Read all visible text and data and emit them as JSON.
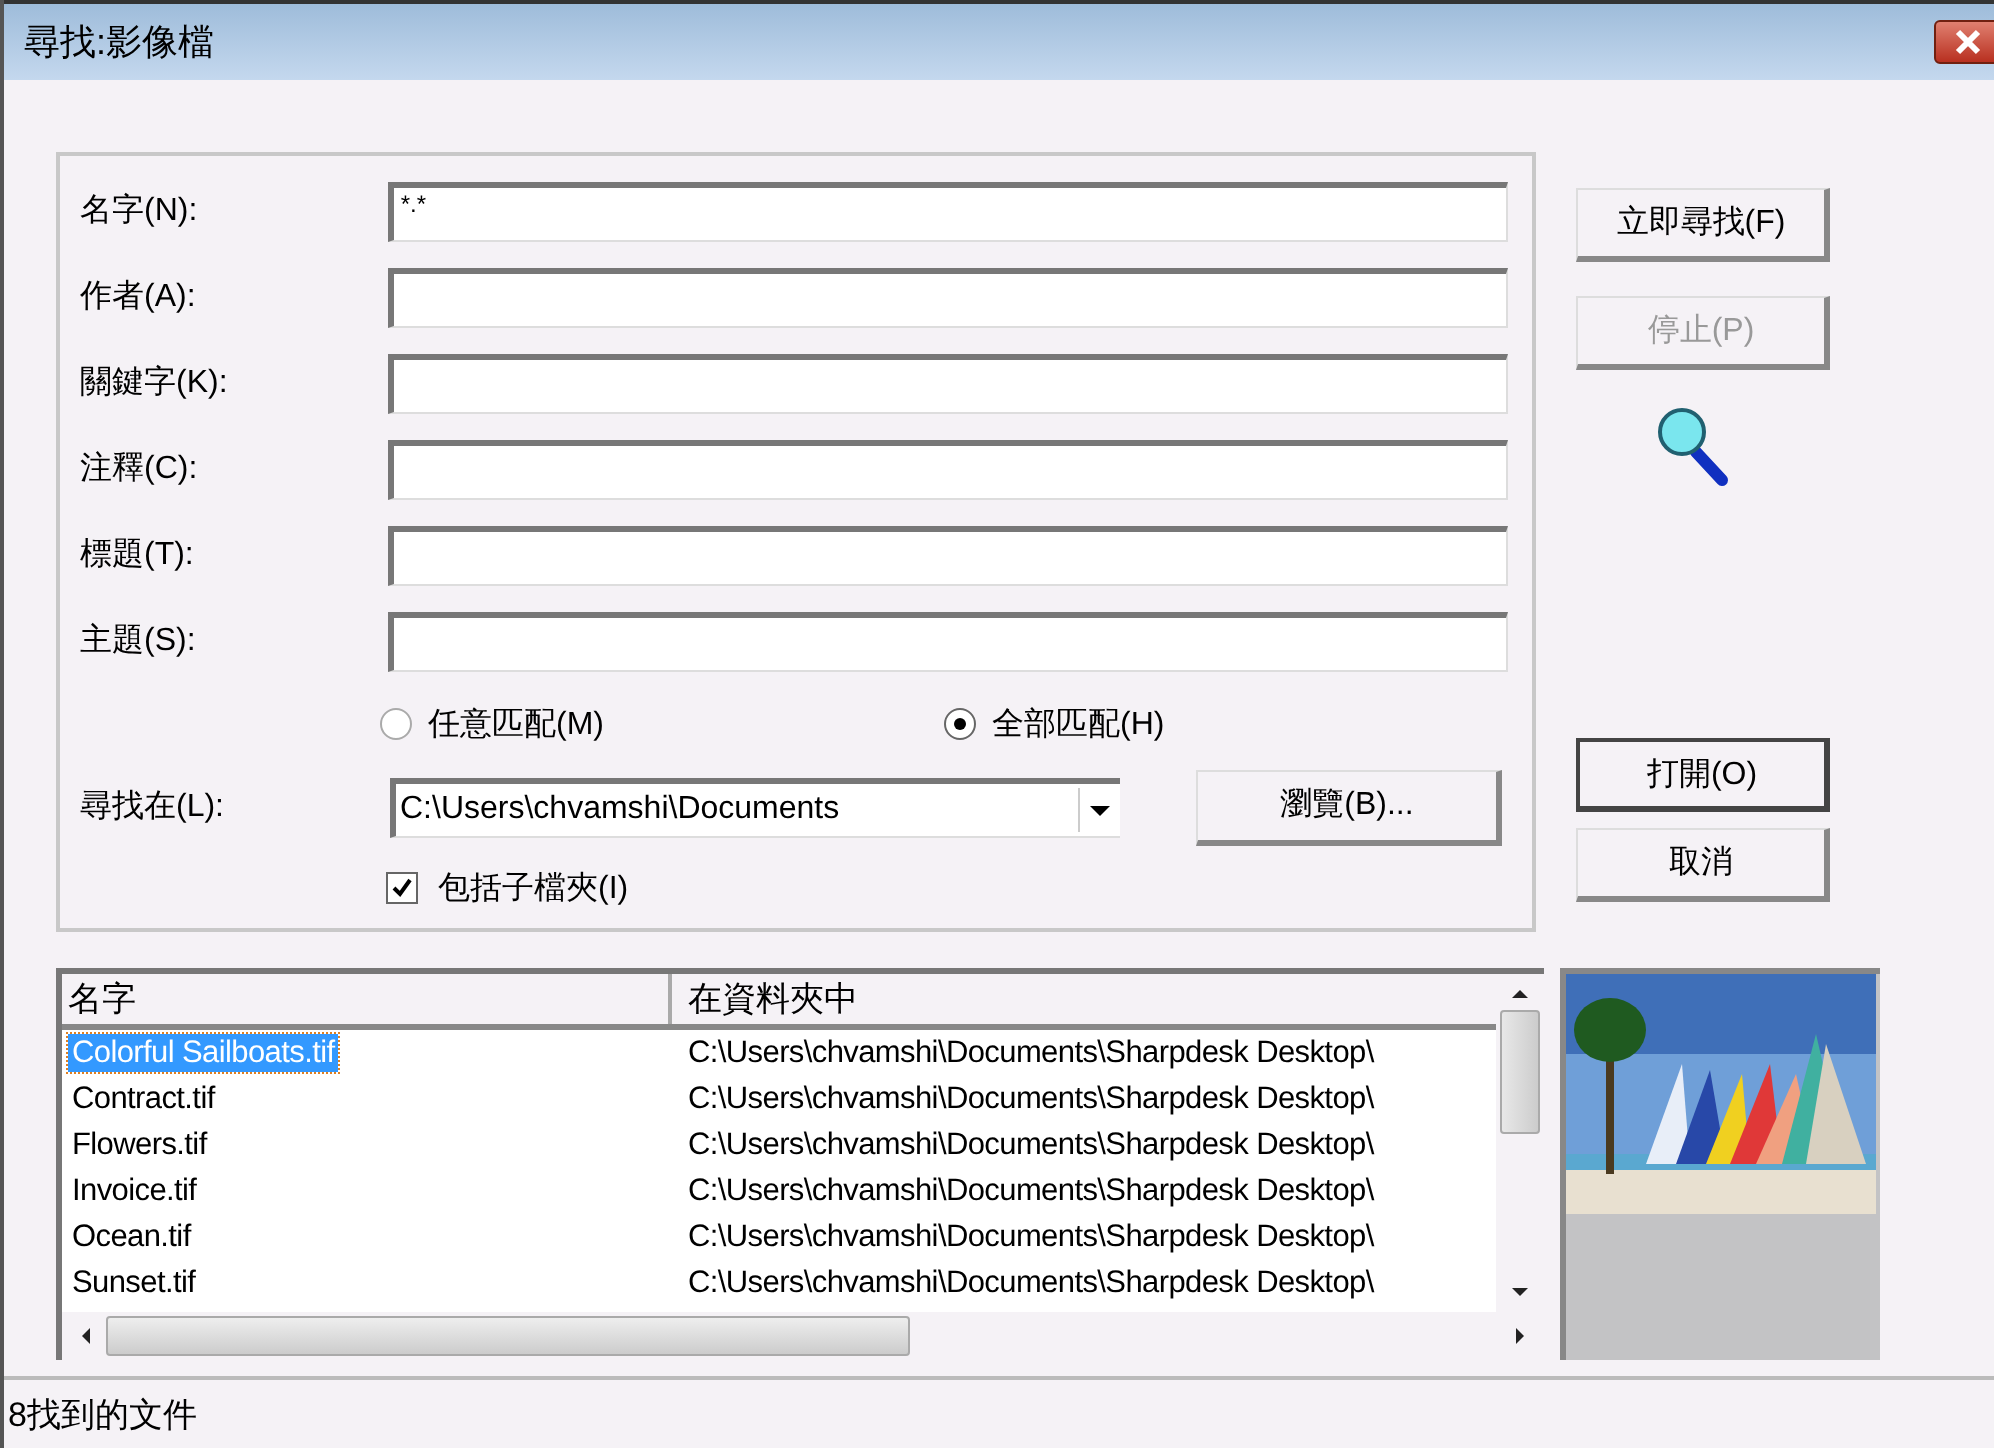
{
  "window": {
    "title": "尋找:影像檔"
  },
  "fields": [
    {
      "label": "名字(N):",
      "value": "*.*"
    },
    {
      "label": "作者(A):"
    },
    {
      "label": "關鍵字(K):"
    },
    {
      "label": "注釋(C):"
    },
    {
      "label": "標題(T):"
    },
    {
      "label": "主題(S):"
    }
  ],
  "match": [
    {
      "label": "任意匹配(M)",
      "selected": false
    },
    {
      "label": "全部匹配(H)",
      "selected": true
    }
  ],
  "look_in": {
    "label": "尋找在(L):",
    "value": "C:\\Users\\chvamshi\\Documents",
    "browse": "瀏覽(B)..."
  },
  "include_subfolders": {
    "label": "包括子檔夾(I)",
    "checked": true
  },
  "buttons": [
    {
      "label": "立即尋找(F)",
      "disabled": false,
      "default": false
    },
    {
      "label": "停止(P)",
      "disabled": true,
      "default": false
    }
  ],
  "bottom_buttons": [
    {
      "label": "打開(O)",
      "disabled": false,
      "default": true
    },
    {
      "label": "取消",
      "disabled": false,
      "default": false
    }
  ],
  "results": {
    "columns": [
      "名字",
      "在資料夾中"
    ],
    "rows": [
      {
        "name": "Colorful Sailboats.tif",
        "folder": "C:\\Users\\chvamshi\\Documents\\Sharpdesk Desktop\\",
        "selected": true
      },
      {
        "name": "Contract.tif",
        "folder": "C:\\Users\\chvamshi\\Documents\\Sharpdesk Desktop\\",
        "selected": false
      },
      {
        "name": "Flowers.tif",
        "folder": "C:\\Users\\chvamshi\\Documents\\Sharpdesk Desktop\\",
        "selected": false
      },
      {
        "name": "Invoice.tif",
        "folder": "C:\\Users\\chvamshi\\Documents\\Sharpdesk Desktop\\",
        "selected": false
      },
      {
        "name": "Ocean.tif",
        "folder": "C:\\Users\\chvamshi\\Documents\\Sharpdesk Desktop\\",
        "selected": false
      },
      {
        "name": "Sunset.tif",
        "folder": "C:\\Users\\chvamshi\\Documents\\Sharpdesk Desktop\\",
        "selected": false
      }
    ]
  },
  "status_bar": "8找到的文件"
}
